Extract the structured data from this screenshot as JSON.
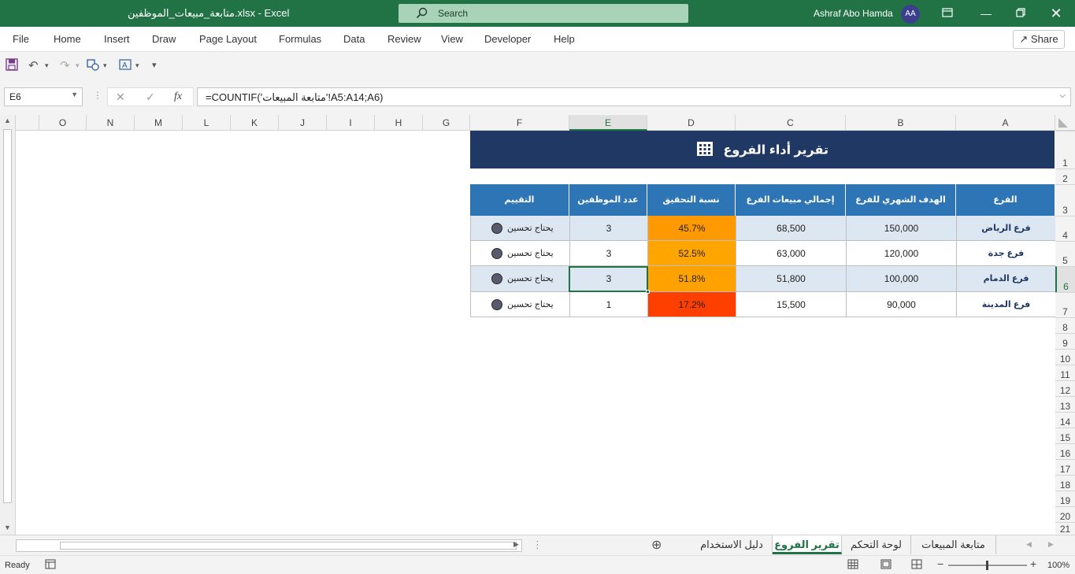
{
  "window": {
    "doc_title": "متابعة_مبيعات_الموظفين.xlsx  -  Excel",
    "search_placeholder": "Search",
    "user_name": "Ashraf Abo Hamda",
    "user_initials": "AA"
  },
  "ribbon": {
    "tabs": [
      "File",
      "Home",
      "Insert",
      "Draw",
      "Page Layout",
      "Formulas",
      "Data",
      "Review",
      "View",
      "Developer",
      "Help"
    ],
    "share_label": "Share"
  },
  "formula_bar": {
    "name_box": "E6",
    "fx_label": "fx",
    "formula": "=COUNTIF('متابعة المبيعات'!A5:A14;A6)"
  },
  "columns": [
    "A",
    "B",
    "C",
    "D",
    "E",
    "F",
    "G",
    "H",
    "I",
    "J",
    "K",
    "L",
    "M",
    "N",
    "O"
  ],
  "selected_column": "E",
  "rows": [
    "1",
    "2",
    "3",
    "4",
    "5",
    "6",
    "7",
    "8",
    "9",
    "10",
    "11",
    "12",
    "13",
    "14",
    "15",
    "16",
    "17",
    "18",
    "19",
    "20",
    "21"
  ],
  "selected_row": "6",
  "report": {
    "title": "تقرير أداء الفروع",
    "headers": [
      "الفرع",
      "الهدف الشهري للفرع",
      "إجمالي مبيعات الفرع",
      "نسبة التحقيق",
      "عدد الموظفين",
      "التقييم"
    ],
    "rows": [
      {
        "branch": "فرع الرياض",
        "target": "150,000",
        "sales": "68,500",
        "pct": "45.7%",
        "staff": "3",
        "rating": "يحتاج تحسين",
        "pct_color": "#ff9900"
      },
      {
        "branch": "فرع جدة",
        "target": "120,000",
        "sales": "63,000",
        "pct": "52.5%",
        "staff": "3",
        "rating": "يحتاج تحسين",
        "pct_color": "#ffa500"
      },
      {
        "branch": "فرع الدمام",
        "target": "100,000",
        "sales": "51,800",
        "pct": "51.8%",
        "staff": "3",
        "rating": "يحتاج تحسين",
        "pct_color": "#ffa200"
      },
      {
        "branch": "فرع المدينة",
        "target": "90,000",
        "sales": "15,500",
        "pct": "17.2%",
        "staff": "1",
        "rating": "يحتاج تحسين",
        "pct_color": "#ff3f00"
      }
    ]
  },
  "sheet_tabs": [
    "متابعة المبيعات",
    "لوحة التحكم",
    "تقرير الفروع",
    "دليل الاستخدام"
  ],
  "active_sheet": "تقرير الفروع",
  "status": {
    "ready": "Ready",
    "zoom": "100%"
  }
}
